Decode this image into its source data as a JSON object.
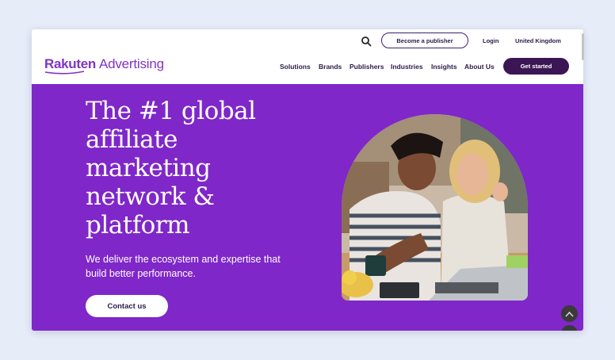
{
  "header": {
    "topbar": {
      "search_icon": "search-icon",
      "become_publisher": "Become a publisher",
      "login": "Login",
      "region": "United Kingdom"
    },
    "logo": {
      "brand": "Rakuten",
      "sub": "Advertising"
    },
    "nav": [
      "Solutions",
      "Brands",
      "Publishers",
      "Industries",
      "Insights",
      "About Us"
    ],
    "cta": "Get started"
  },
  "hero": {
    "headline": [
      "The #1 global",
      "affiliate",
      "marketing",
      "network &",
      "platform"
    ],
    "tagline": "We deliver the ecosystem and expertise that build better performance.",
    "contact_button": "Contact us",
    "background_color": "#7f27c9"
  },
  "colors": {
    "brand_purple": "#7f33c6",
    "dark_purple": "#3b1654",
    "text_dark": "#2b1a4b"
  }
}
